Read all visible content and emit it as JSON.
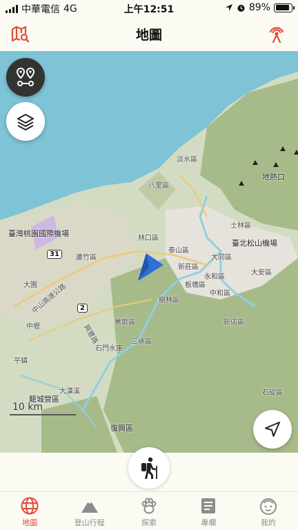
{
  "status": {
    "carrier": "中華電信",
    "network": "4G",
    "time": "上午12:51",
    "battery": "89%",
    "battery_level": 0.89
  },
  "header": {
    "title": "地圖"
  },
  "map": {
    "labels": {
      "taoyuan_airport": "臺灣桃園國際機場",
      "songshan_airport": "臺北松山機場",
      "longtan": "龍城營區",
      "fuxing": "復興區",
      "linkou": "林口區",
      "bali": "八里區",
      "tamsui": "淡水區",
      "shilin": "士林區",
      "datong": "大同區",
      "daan": "大安區",
      "banqiao": "板橋區",
      "zhonghe": "中和區",
      "xindian": "新店區",
      "shulin": "樹林區",
      "yingge": "鶯歌區",
      "taishan": "泰山區",
      "xinzhuang": "新莊區",
      "sanxia": "三峽區",
      "zhongli": "中壢",
      "dayuan": "大園",
      "zhongshan_hwy": "中山高速公路",
      "xingfeng_rd": "興豐路",
      "dixiaq": "地熱口",
      "shimen": "石門水庫",
      "dahan": "大漢溪",
      "luzhu": "蘆竹區",
      "pingzhen": "平鎮",
      "shiding": "石碇區",
      "yonghe": "永和區",
      "route_31": "31",
      "route_2": "2"
    },
    "scale_label": "10 km"
  },
  "tabs": [
    {
      "label": "地圖",
      "icon": "globe-icon",
      "active": true
    },
    {
      "label": "登山行程",
      "icon": "mountain-icon",
      "active": false
    },
    {
      "label": "探索",
      "icon": "paw-icon",
      "active": false
    },
    {
      "label": "專欄",
      "icon": "article-icon",
      "active": false
    },
    {
      "label": "我的",
      "icon": "face-icon",
      "active": false
    }
  ],
  "colors": {
    "accent": "#e14a3a",
    "sea": "#7fc3d6",
    "land": "#d3dcc3",
    "forest": "#a7bb8a",
    "urban": "#e6e3dc",
    "river": "#8fcfe3",
    "tab_inactive": "#8d8d8d"
  }
}
